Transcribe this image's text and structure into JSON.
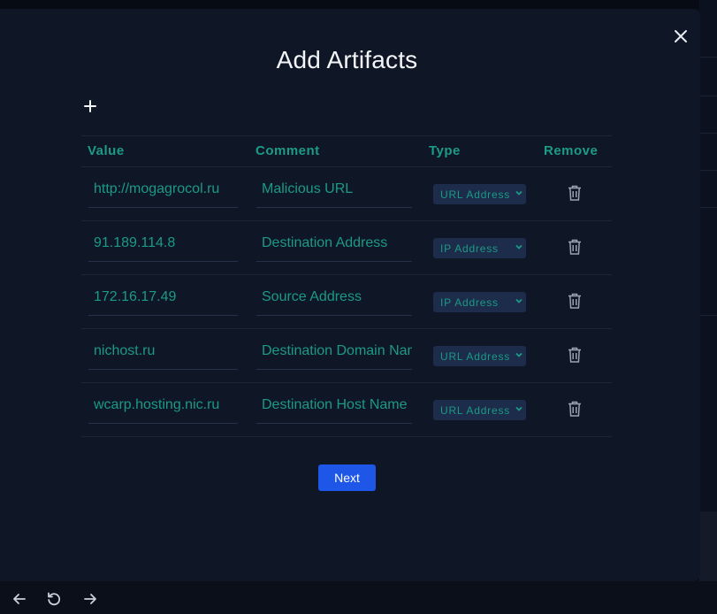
{
  "modal": {
    "title": "Add Artifacts"
  },
  "table": {
    "headers": {
      "value": "Value",
      "comment": "Comment",
      "type": "Type",
      "remove": "Remove"
    },
    "rows": [
      {
        "value": "http://mogagrocol.ru",
        "comment": "Malicious URL",
        "type": "URL Address"
      },
      {
        "value": "91.189.114.8",
        "comment": "Destination Address",
        "type": "IP Address"
      },
      {
        "value": "172.16.17.49",
        "comment": "Source Address",
        "type": "IP Address"
      },
      {
        "value": "nichost.ru",
        "comment": "Destination Domain Name",
        "type": "URL Address"
      },
      {
        "value": "wcarp.hosting.nic.ru",
        "comment": "Destination Host Name",
        "type": "URL Address"
      }
    ]
  },
  "actions": {
    "next_label": "Next"
  },
  "icons": {
    "close": "close-icon",
    "add": "plus-icon",
    "remove": "trash-icon",
    "dropdown": "chevron-down-icon",
    "back": "arrow-left-icon",
    "reload": "reload-icon",
    "forward": "arrow-right-icon"
  },
  "colors": {
    "accent_teal": "#1b9a86",
    "primary_button": "#1e56e8",
    "modal_bg": "#0f1626",
    "select_bg": "#1d2c4a"
  }
}
